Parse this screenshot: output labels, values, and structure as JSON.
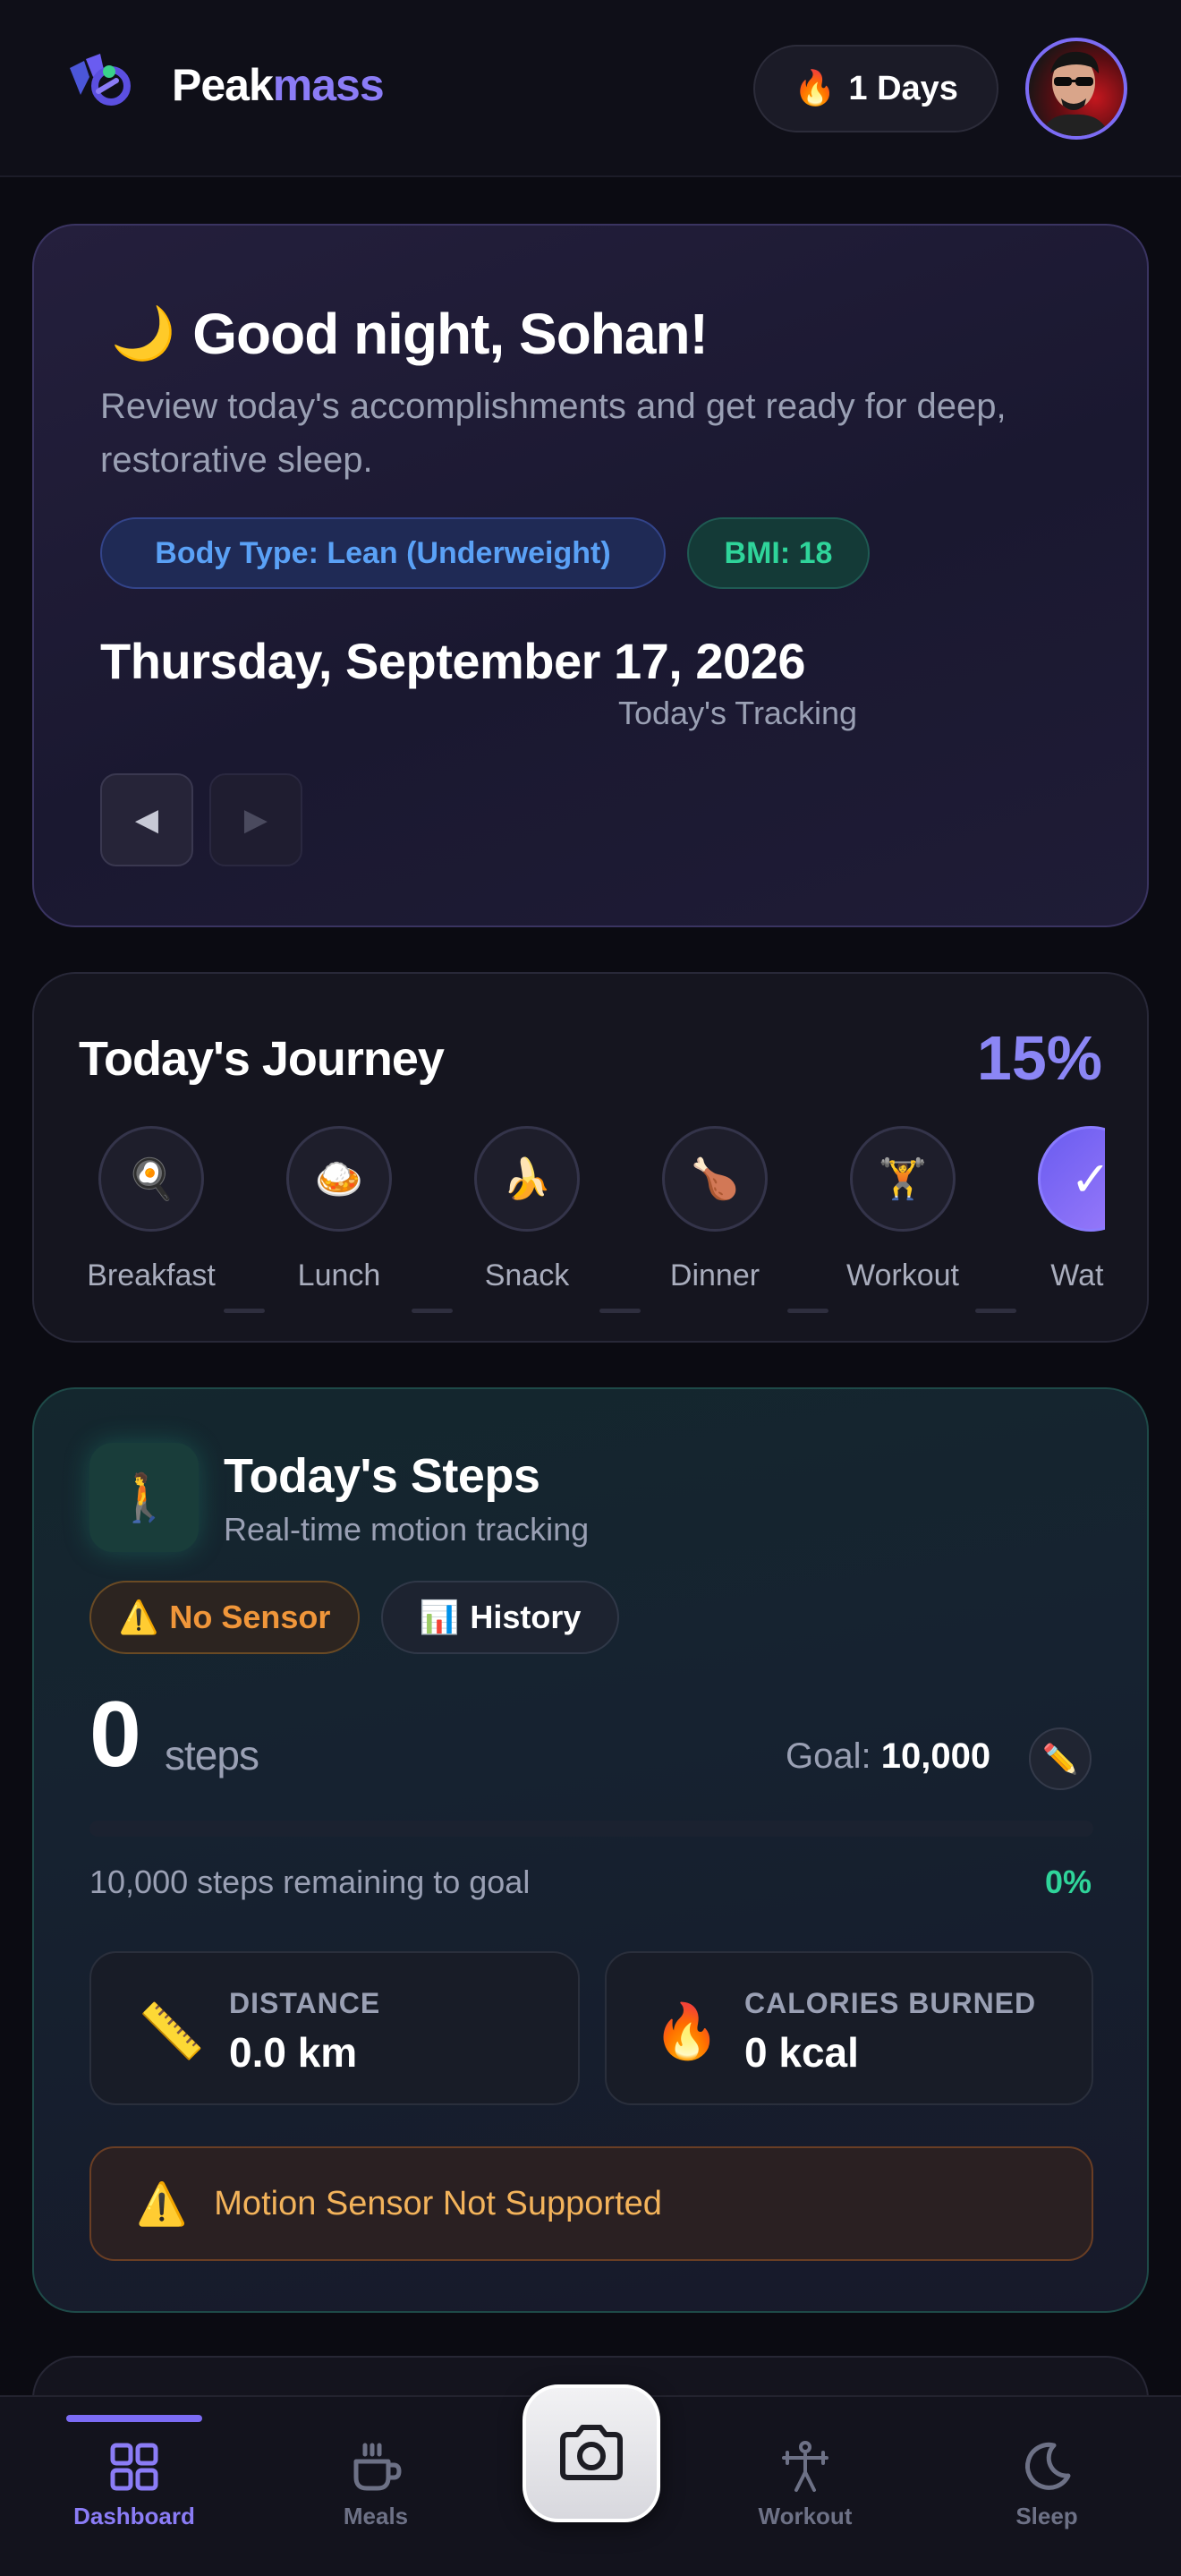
{
  "header": {
    "brand_part1": "Peak",
    "brand_part2": "mass",
    "streak_icon": "🔥",
    "streak_label": "1 Days"
  },
  "greeting": {
    "icon": "🌙",
    "title": "Good night, Sohan!",
    "subtitle": "Review today's accomplishments and get ready for deep, restorative sleep.",
    "body_type": "Body Type: Lean (Underweight)",
    "bmi": "BMI: 18",
    "date": "Thursday, September 17, 2026",
    "tracking_label": "Today's Tracking",
    "prev_glyph": "◀",
    "next_glyph": "▶"
  },
  "journey": {
    "title": "Today's Journey",
    "percent": "15%",
    "steps": [
      {
        "label": "Breakfast",
        "icon": "🍳",
        "done": false
      },
      {
        "label": "Lunch",
        "icon": "🍛",
        "done": false
      },
      {
        "label": "Snack",
        "icon": "🍌",
        "done": false
      },
      {
        "label": "Dinner",
        "icon": "🍗",
        "done": false
      },
      {
        "label": "Workout",
        "icon": "🏋️",
        "done": false
      },
      {
        "label": "Water",
        "icon": "✓",
        "done": true
      }
    ]
  },
  "steps": {
    "icon": "🚶",
    "title": "Today's Steps",
    "subtitle": "Real-time motion tracking",
    "sensor_chip_icon": "⚠️",
    "sensor_chip": "No Sensor",
    "history_chip_icon": "📊",
    "history_chip": "History",
    "count": "0",
    "unit": "steps",
    "goal_label": "Goal:",
    "goal_value": "10,000",
    "edit_icon": "✏️",
    "progress_fraction": 0,
    "remaining": "10,000 steps remaining to goal",
    "percent": "0%",
    "distance_icon": "📏",
    "distance_label": "DISTANCE",
    "distance_value": "0.0 km",
    "calories_icon": "🔥",
    "calories_label": "CALORIES BURNED",
    "calories_value": "0 kcal",
    "warning_icon": "⚠️",
    "warning": "Motion Sensor Not Supported"
  },
  "bottom_nav": {
    "items": [
      {
        "label": "Dashboard",
        "active": true
      },
      {
        "label": "Meals",
        "active": false
      },
      {
        "label": "Workout",
        "active": false
      },
      {
        "label": "Sleep",
        "active": false
      }
    ]
  },
  "colors": {
    "accent": "#8b7cf6",
    "success": "#2fd49a",
    "warning": "#f0963a",
    "info": "#5aa1f6"
  }
}
